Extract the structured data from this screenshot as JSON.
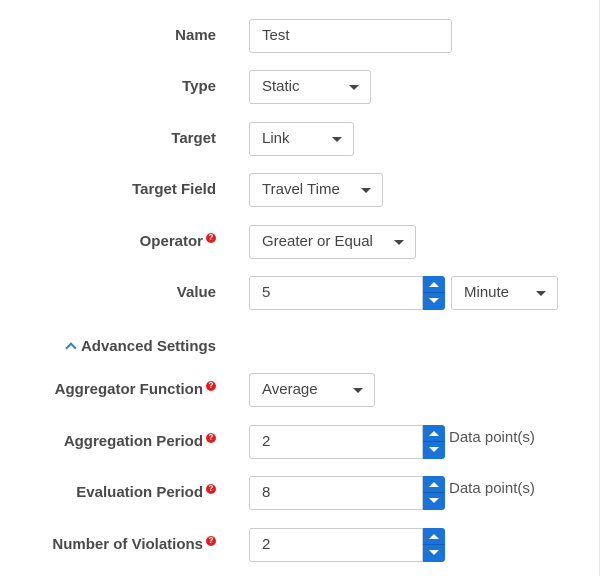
{
  "form": {
    "name": {
      "label": "Name",
      "value": "Test"
    },
    "type": {
      "label": "Type",
      "value": "Static"
    },
    "target": {
      "label": "Target",
      "value": "Link"
    },
    "target_field": {
      "label": "Target Field",
      "value": "Travel Time"
    },
    "operator": {
      "label": "Operator",
      "value": "Greater or Equal",
      "help_icon": "question-icon"
    },
    "value": {
      "label": "Value",
      "value": "5",
      "unit": "Minute"
    },
    "advanced": {
      "label": "Advanced Settings",
      "expanded": true,
      "icon": "chevron-up-icon"
    },
    "aggregator_function": {
      "label": "Aggregator Function",
      "value": "Average",
      "help_icon": "question-icon"
    },
    "aggregation_period": {
      "label": "Aggregation Period",
      "value": "2",
      "unit": "Data point(s)",
      "help_icon": "question-icon"
    },
    "evaluation_period": {
      "label": "Evaluation Period",
      "value": "8",
      "unit": "Data point(s)",
      "help_icon": "question-icon"
    },
    "number_of_violations": {
      "label": "Number of Violations",
      "value": "2",
      "help_icon": "question-icon"
    }
  },
  "colors": {
    "accent": "#1a73d9",
    "help_icon": "#e02020",
    "label": "#4a4a4a"
  }
}
